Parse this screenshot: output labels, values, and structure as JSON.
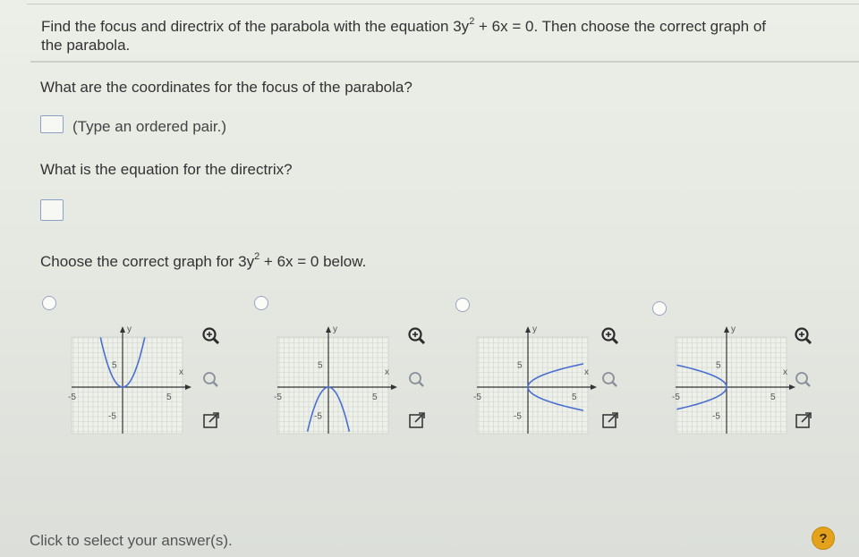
{
  "question": {
    "intro_part1": "Find the focus and directrix of the parabola with the equation 3y",
    "intro_exp": "2",
    "intro_part2": " + 6x = 0. Then choose the correct graph of",
    "intro_line2": "the parabola."
  },
  "focus": {
    "prompt": "What are the coordinates for the focus of the parabola?",
    "hint": "(Type an ordered pair.)"
  },
  "directrix": {
    "prompt": "What is the equation for the directrix?"
  },
  "graph_choice": {
    "prompt_part1": "Choose the correct graph for 3y",
    "prompt_exp": "2",
    "prompt_part2": " + 6x = 0 below."
  },
  "graphs": [
    {
      "shape": "opens-up",
      "tick_5": "5",
      "tick_neg5": "-5",
      "y_label": "y",
      "x_label": "x"
    },
    {
      "shape": "opens-down",
      "tick_5": "5",
      "tick_neg5": "-5",
      "y_label": "y",
      "x_label": "x"
    },
    {
      "shape": "opens-right",
      "tick_5": "5",
      "tick_neg5": "-5",
      "y_label": "y",
      "x_label": "x"
    },
    {
      "shape": "opens-left",
      "tick_5": "5",
      "tick_neg5": "-5",
      "y_label": "y",
      "x_label": "x"
    }
  ],
  "tools": {
    "zoom_in": "zoom-in-icon",
    "zoom_out": "zoom-out-icon",
    "expand": "expand-icon"
  },
  "footer": {
    "status": "Click to select your answer(s)."
  },
  "help": {
    "label": "?"
  },
  "colors": {
    "curve": "#4a6fd0",
    "grid": "#cfd2cc",
    "help_bg": "#e4a21b"
  }
}
